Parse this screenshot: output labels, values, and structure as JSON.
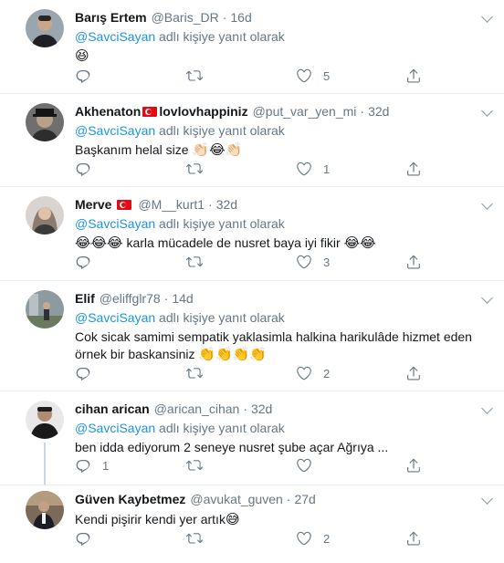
{
  "reply_prefix": "adlı kişiye yanıt olarak",
  "tweets": [
    {
      "name": "Barış Ertem",
      "handle": "@Baris_DR",
      "time": "16d",
      "mention": "@SavciSayan",
      "text": "",
      "emojis": "😆",
      "reply_count": "",
      "retweet_count": "",
      "like_count": "5"
    },
    {
      "name_before_flag": "Akhenaton",
      "name_after_flag": "lovlovhappiniz",
      "handle": "@put_var_yen_mi",
      "time": "32d",
      "mention": "@SavciSayan",
      "text": "Başkanım helal size",
      "emojis": "👏🏻😂👏🏻",
      "reply_count": "",
      "retweet_count": "",
      "like_count": "1"
    },
    {
      "name": "Merve",
      "handle": "@M__kurt1",
      "time": "32d",
      "mention": "@SavciSayan",
      "emojis_before": "😂😂😂",
      "text": "karla mücadele de nusret baya iyi fikir",
      "emojis": "😂😂",
      "reply_count": "",
      "retweet_count": "",
      "like_count": "3"
    },
    {
      "name": "Elif",
      "handle": "@eliffglr78",
      "time": "14d",
      "mention": "@SavciSayan",
      "text": "Cok sicak samimi sempatik yaklasimla halkina harikulâde hizmet eden örnek bir baskansiniz",
      "emojis": "👏👏👏👏",
      "reply_count": "",
      "retweet_count": "",
      "like_count": "2"
    },
    {
      "name": "cihan arican",
      "handle": "@arican_cihan",
      "time": "32d",
      "mention": "@SavciSayan",
      "text": "ben idda ediyorum 2 seneye  nusret şube açar  Ağrıya ...",
      "reply_count": "1",
      "retweet_count": "",
      "like_count": ""
    },
    {
      "name": "Güven Kaybetmez",
      "handle": "@avukat_guven",
      "time": "27d",
      "text": "Kendi pişirir kendi yer artık",
      "emojis": "😅",
      "reply_count": "",
      "retweet_count": "",
      "like_count": "2"
    }
  ]
}
